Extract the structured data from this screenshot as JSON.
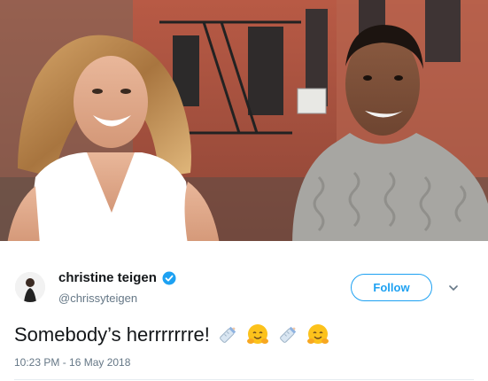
{
  "tweet": {
    "display_name": "christine teigen",
    "handle": "@chrissyteigen",
    "follow_label": "Follow",
    "text": "Somebody’s herrrrrrre!",
    "timestamp": "10:23 PM - 16 May 2018",
    "emojis": [
      "baby-bottle-icon",
      "hugging-face-icon",
      "baby-bottle-icon",
      "hugging-face-icon"
    ],
    "verified_color": "#1da1f2",
    "accent_color": "#1da1f2"
  }
}
